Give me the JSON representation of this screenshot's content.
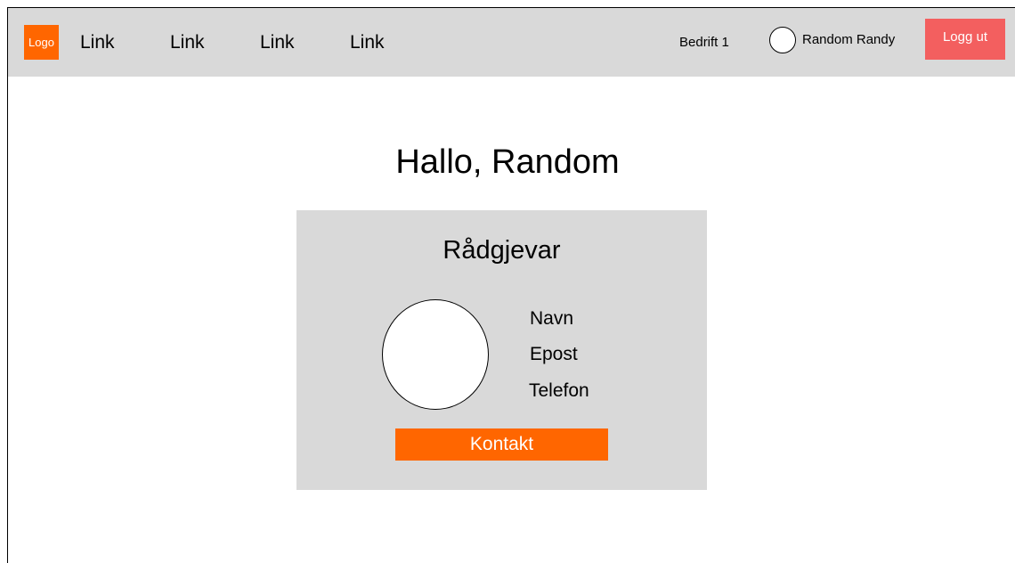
{
  "header": {
    "logo_text": "Logo",
    "links": [
      "Link",
      "Link",
      "Link",
      "Link"
    ],
    "company": "Bedrift 1",
    "user_name": "Random Randy",
    "logout_label": "Logg ut"
  },
  "main": {
    "greeting": "Hallo, Random",
    "advisor_card": {
      "title": "Rådgjevar",
      "name_label": "Navn",
      "email_label": "Epost",
      "phone_label": "Telefon",
      "contact_label": "Kontakt"
    }
  },
  "colors": {
    "brand_orange": "#ff6600",
    "logout_red": "#f35f5f",
    "panel_gray": "#d9d9d9"
  }
}
